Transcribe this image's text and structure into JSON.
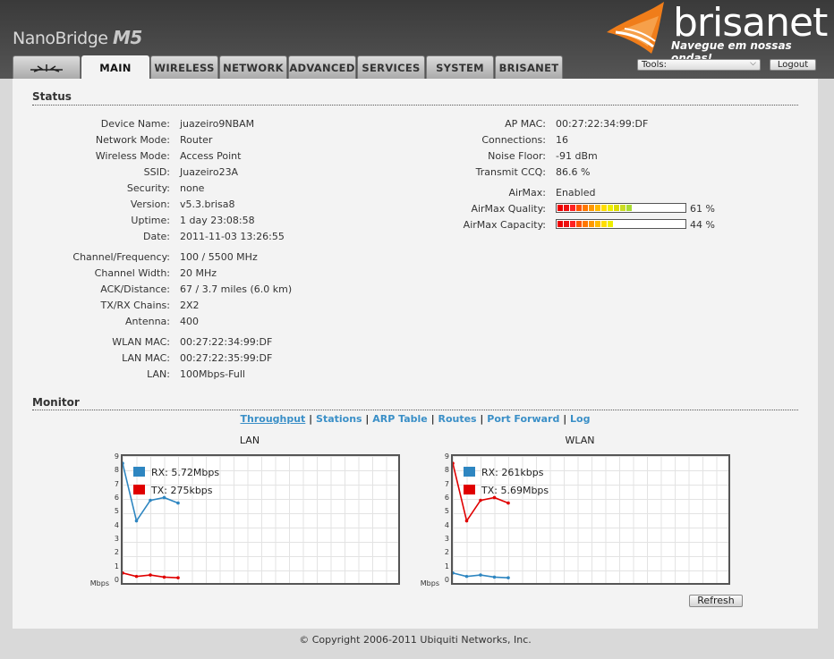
{
  "header": {
    "product_name": "NanoBridge",
    "product_model": "M5",
    "brand_name": "brisanet",
    "brand_slogan": "Navegue em nossas ondas!",
    "tools_label": "Tools:",
    "logout_label": "Logout"
  },
  "tabs": [
    {
      "label": "",
      "icon": "ubiquiti-logo-icon"
    },
    {
      "label": "MAIN",
      "active": true
    },
    {
      "label": "WIRELESS"
    },
    {
      "label": "NETWORK"
    },
    {
      "label": "ADVANCED"
    },
    {
      "label": "SERVICES"
    },
    {
      "label": "SYSTEM"
    },
    {
      "label": "BRISANET"
    }
  ],
  "status": {
    "title": "Status",
    "left": [
      {
        "label": "Device Name:",
        "value": "juazeiro9NBAM"
      },
      {
        "label": "Network Mode:",
        "value": "Router"
      },
      {
        "label": "Wireless Mode:",
        "value": "Access Point"
      },
      {
        "label": "SSID:",
        "value": "Juazeiro23A"
      },
      {
        "label": "Security:",
        "value": "none"
      },
      {
        "label": "Version:",
        "value": "v5.3.brisa8"
      },
      {
        "label": "Uptime:",
        "value": "1 day 23:08:58"
      },
      {
        "label": "Date:",
        "value": "2011-11-03 13:26:55"
      },
      {
        "label": "Channel/Frequency:",
        "value": "100 / 5500 MHz"
      },
      {
        "label": "Channel Width:",
        "value": "20 MHz"
      },
      {
        "label": "ACK/Distance:",
        "value": "67 / 3.7 miles (6.0 km)"
      },
      {
        "label": "TX/RX Chains:",
        "value": "2X2"
      },
      {
        "label": "Antenna:",
        "value": "400"
      },
      {
        "label": "WLAN MAC:",
        "value": "00:27:22:34:99:DF"
      },
      {
        "label": "LAN MAC:",
        "value": "00:27:22:35:99:DF"
      },
      {
        "label": "LAN:",
        "value": "100Mbps-Full"
      }
    ],
    "right": [
      {
        "label": "AP MAC:",
        "value": "00:27:22:34:99:DF"
      },
      {
        "label": "Connections:",
        "value": "16"
      },
      {
        "label": "Noise Floor:",
        "value": "-91 dBm"
      },
      {
        "label": "Transmit CCQ:",
        "value": "86.6 %"
      },
      {
        "label": "AirMax:",
        "value": "Enabled"
      }
    ],
    "airmax_quality": {
      "label": "AirMax Quality:",
      "value": "61 %",
      "fraction": 0.61
    },
    "airmax_capacity": {
      "label": "AirMax Capacity:",
      "value": "44 %",
      "fraction": 0.44
    }
  },
  "monitor": {
    "title": "Monitor",
    "links": [
      "Throughput",
      "Stations",
      "ARP Table",
      "Routes",
      "Port Forward",
      "Log"
    ],
    "selected_link": "Throughput",
    "refresh_label": "Refresh"
  },
  "chart_data": [
    {
      "type": "line",
      "title": "LAN",
      "ylabel": "Mbps",
      "ylim": [
        0,
        9
      ],
      "yticks": [
        "0",
        "1",
        "2",
        "3",
        "4",
        "5",
        "6",
        "7",
        "8",
        "9"
      ],
      "series": [
        {
          "name": "RX: 5.72Mbps",
          "color": "#2e86c1",
          "values": [
            8.6,
            4.4,
            5.9,
            6.1,
            5.7
          ]
        },
        {
          "name": "TX: 275kbps",
          "color": "#e00000",
          "values": [
            0.6,
            0.35,
            0.45,
            0.3,
            0.25
          ]
        }
      ]
    },
    {
      "type": "line",
      "title": "WLAN",
      "ylabel": "Mbps",
      "ylim": [
        0,
        9
      ],
      "yticks": [
        "0",
        "1",
        "2",
        "3",
        "4",
        "5",
        "6",
        "7",
        "8",
        "9"
      ],
      "series": [
        {
          "name": "RX: 261kbps",
          "color": "#2e86c1",
          "values": [
            0.6,
            0.35,
            0.45,
            0.3,
            0.25
          ]
        },
        {
          "name": "TX: 5.69Mbps",
          "color": "#e00000",
          "values": [
            8.6,
            4.4,
            5.9,
            6.1,
            5.7
          ]
        }
      ]
    }
  ],
  "footer": {
    "copyright": "© Copyright 2006-2011 Ubiquiti Networks, Inc."
  }
}
